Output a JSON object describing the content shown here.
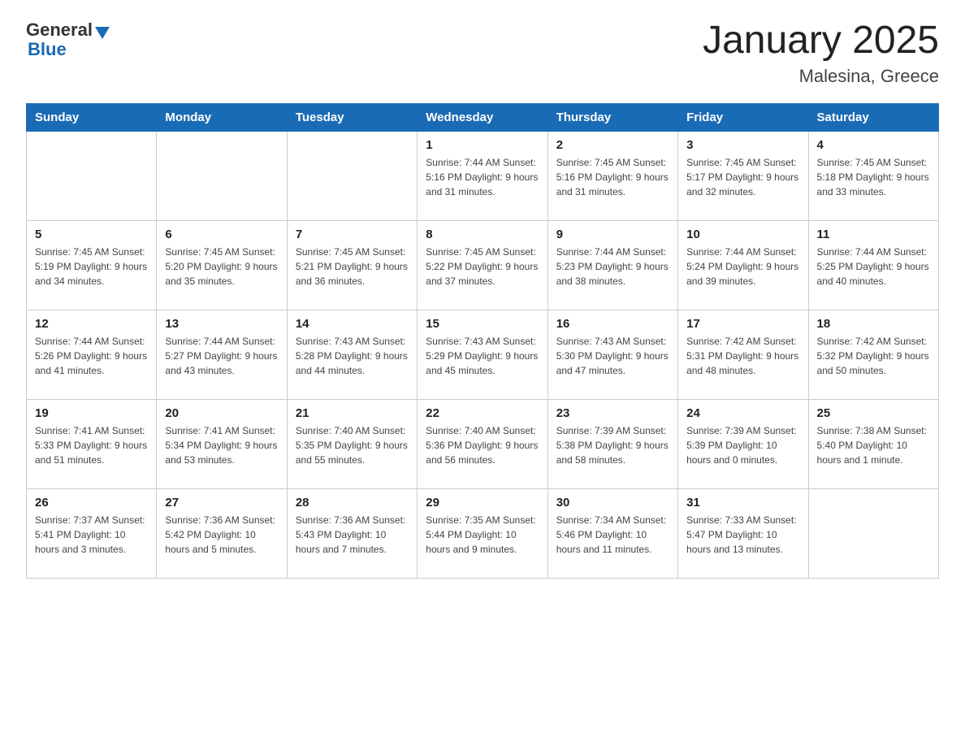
{
  "header": {
    "logo_general": "General",
    "logo_blue": "Blue",
    "title": "January 2025",
    "subtitle": "Malesina, Greece"
  },
  "columns": [
    "Sunday",
    "Monday",
    "Tuesday",
    "Wednesday",
    "Thursday",
    "Friday",
    "Saturday"
  ],
  "weeks": [
    [
      {
        "day": "",
        "info": ""
      },
      {
        "day": "",
        "info": ""
      },
      {
        "day": "",
        "info": ""
      },
      {
        "day": "1",
        "info": "Sunrise: 7:44 AM\nSunset: 5:16 PM\nDaylight: 9 hours\nand 31 minutes."
      },
      {
        "day": "2",
        "info": "Sunrise: 7:45 AM\nSunset: 5:16 PM\nDaylight: 9 hours\nand 31 minutes."
      },
      {
        "day": "3",
        "info": "Sunrise: 7:45 AM\nSunset: 5:17 PM\nDaylight: 9 hours\nand 32 minutes."
      },
      {
        "day": "4",
        "info": "Sunrise: 7:45 AM\nSunset: 5:18 PM\nDaylight: 9 hours\nand 33 minutes."
      }
    ],
    [
      {
        "day": "5",
        "info": "Sunrise: 7:45 AM\nSunset: 5:19 PM\nDaylight: 9 hours\nand 34 minutes."
      },
      {
        "day": "6",
        "info": "Sunrise: 7:45 AM\nSunset: 5:20 PM\nDaylight: 9 hours\nand 35 minutes."
      },
      {
        "day": "7",
        "info": "Sunrise: 7:45 AM\nSunset: 5:21 PM\nDaylight: 9 hours\nand 36 minutes."
      },
      {
        "day": "8",
        "info": "Sunrise: 7:45 AM\nSunset: 5:22 PM\nDaylight: 9 hours\nand 37 minutes."
      },
      {
        "day": "9",
        "info": "Sunrise: 7:44 AM\nSunset: 5:23 PM\nDaylight: 9 hours\nand 38 minutes."
      },
      {
        "day": "10",
        "info": "Sunrise: 7:44 AM\nSunset: 5:24 PM\nDaylight: 9 hours\nand 39 minutes."
      },
      {
        "day": "11",
        "info": "Sunrise: 7:44 AM\nSunset: 5:25 PM\nDaylight: 9 hours\nand 40 minutes."
      }
    ],
    [
      {
        "day": "12",
        "info": "Sunrise: 7:44 AM\nSunset: 5:26 PM\nDaylight: 9 hours\nand 41 minutes."
      },
      {
        "day": "13",
        "info": "Sunrise: 7:44 AM\nSunset: 5:27 PM\nDaylight: 9 hours\nand 43 minutes."
      },
      {
        "day": "14",
        "info": "Sunrise: 7:43 AM\nSunset: 5:28 PM\nDaylight: 9 hours\nand 44 minutes."
      },
      {
        "day": "15",
        "info": "Sunrise: 7:43 AM\nSunset: 5:29 PM\nDaylight: 9 hours\nand 45 minutes."
      },
      {
        "day": "16",
        "info": "Sunrise: 7:43 AM\nSunset: 5:30 PM\nDaylight: 9 hours\nand 47 minutes."
      },
      {
        "day": "17",
        "info": "Sunrise: 7:42 AM\nSunset: 5:31 PM\nDaylight: 9 hours\nand 48 minutes."
      },
      {
        "day": "18",
        "info": "Sunrise: 7:42 AM\nSunset: 5:32 PM\nDaylight: 9 hours\nand 50 minutes."
      }
    ],
    [
      {
        "day": "19",
        "info": "Sunrise: 7:41 AM\nSunset: 5:33 PM\nDaylight: 9 hours\nand 51 minutes."
      },
      {
        "day": "20",
        "info": "Sunrise: 7:41 AM\nSunset: 5:34 PM\nDaylight: 9 hours\nand 53 minutes."
      },
      {
        "day": "21",
        "info": "Sunrise: 7:40 AM\nSunset: 5:35 PM\nDaylight: 9 hours\nand 55 minutes."
      },
      {
        "day": "22",
        "info": "Sunrise: 7:40 AM\nSunset: 5:36 PM\nDaylight: 9 hours\nand 56 minutes."
      },
      {
        "day": "23",
        "info": "Sunrise: 7:39 AM\nSunset: 5:38 PM\nDaylight: 9 hours\nand 58 minutes."
      },
      {
        "day": "24",
        "info": "Sunrise: 7:39 AM\nSunset: 5:39 PM\nDaylight: 10 hours\nand 0 minutes."
      },
      {
        "day": "25",
        "info": "Sunrise: 7:38 AM\nSunset: 5:40 PM\nDaylight: 10 hours\nand 1 minute."
      }
    ],
    [
      {
        "day": "26",
        "info": "Sunrise: 7:37 AM\nSunset: 5:41 PM\nDaylight: 10 hours\nand 3 minutes."
      },
      {
        "day": "27",
        "info": "Sunrise: 7:36 AM\nSunset: 5:42 PM\nDaylight: 10 hours\nand 5 minutes."
      },
      {
        "day": "28",
        "info": "Sunrise: 7:36 AM\nSunset: 5:43 PM\nDaylight: 10 hours\nand 7 minutes."
      },
      {
        "day": "29",
        "info": "Sunrise: 7:35 AM\nSunset: 5:44 PM\nDaylight: 10 hours\nand 9 minutes."
      },
      {
        "day": "30",
        "info": "Sunrise: 7:34 AM\nSunset: 5:46 PM\nDaylight: 10 hours\nand 11 minutes."
      },
      {
        "day": "31",
        "info": "Sunrise: 7:33 AM\nSunset: 5:47 PM\nDaylight: 10 hours\nand 13 minutes."
      },
      {
        "day": "",
        "info": ""
      }
    ]
  ]
}
